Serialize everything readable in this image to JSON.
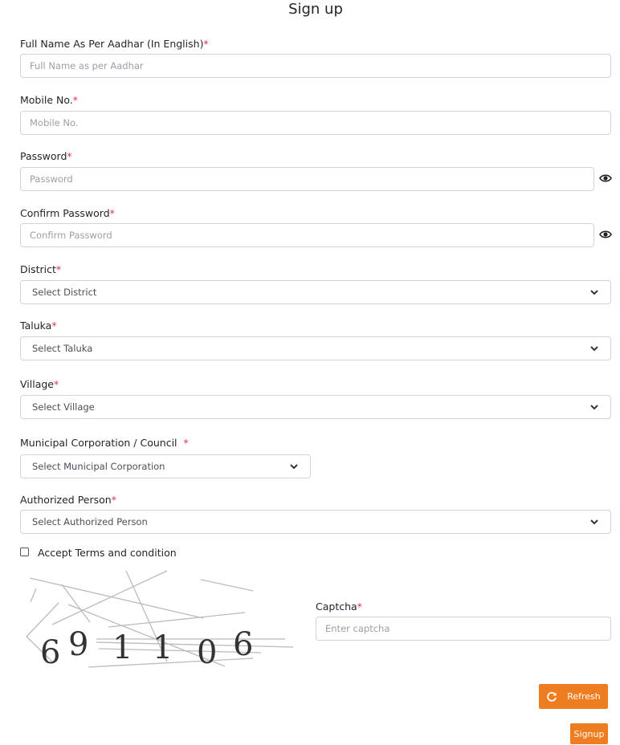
{
  "page": {
    "title": "Sign up"
  },
  "form": {
    "required_marker": "*",
    "full_name": {
      "label": "Full Name As Per Aadhar (In English)",
      "placeholder": "Full Name as per Aadhar",
      "value": ""
    },
    "mobile": {
      "label": "Mobile No.",
      "placeholder": "Mobile No.",
      "value": ""
    },
    "password": {
      "label": "Password",
      "placeholder": "Password",
      "value": "",
      "toggle_icon": "eye-icon"
    },
    "confirm_password": {
      "label": "Confirm Password",
      "placeholder": "Confirm Password",
      "value": "",
      "toggle_icon": "eye-icon"
    },
    "district": {
      "label": "District",
      "selected": "Select District"
    },
    "taluka": {
      "label": "Taluka",
      "selected": "Select Taluka"
    },
    "village": {
      "label": "Village",
      "selected": "Select Village"
    },
    "municipal": {
      "label": "Municipal Corporation / Council ",
      "selected": "Select Municipal Corporation"
    },
    "authorized_person": {
      "label": "Authorized Person",
      "selected": "Select Authorized Person"
    },
    "terms": {
      "label": "Accept Terms and condition",
      "checked": false
    },
    "captcha": {
      "label": "Captcha",
      "placeholder": "Enter captcha",
      "value": "",
      "image_text": "691106",
      "digits": [
        "6",
        "9",
        "1",
        "1",
        "0",
        "6"
      ]
    }
  },
  "buttons": {
    "refresh": {
      "label": "Refresh",
      "icon": "refresh-icon"
    },
    "signup": {
      "label": "Signup"
    }
  },
  "colors": {
    "accent": "#ee7d22",
    "required": "#dc3545",
    "border": "#ced4da"
  }
}
